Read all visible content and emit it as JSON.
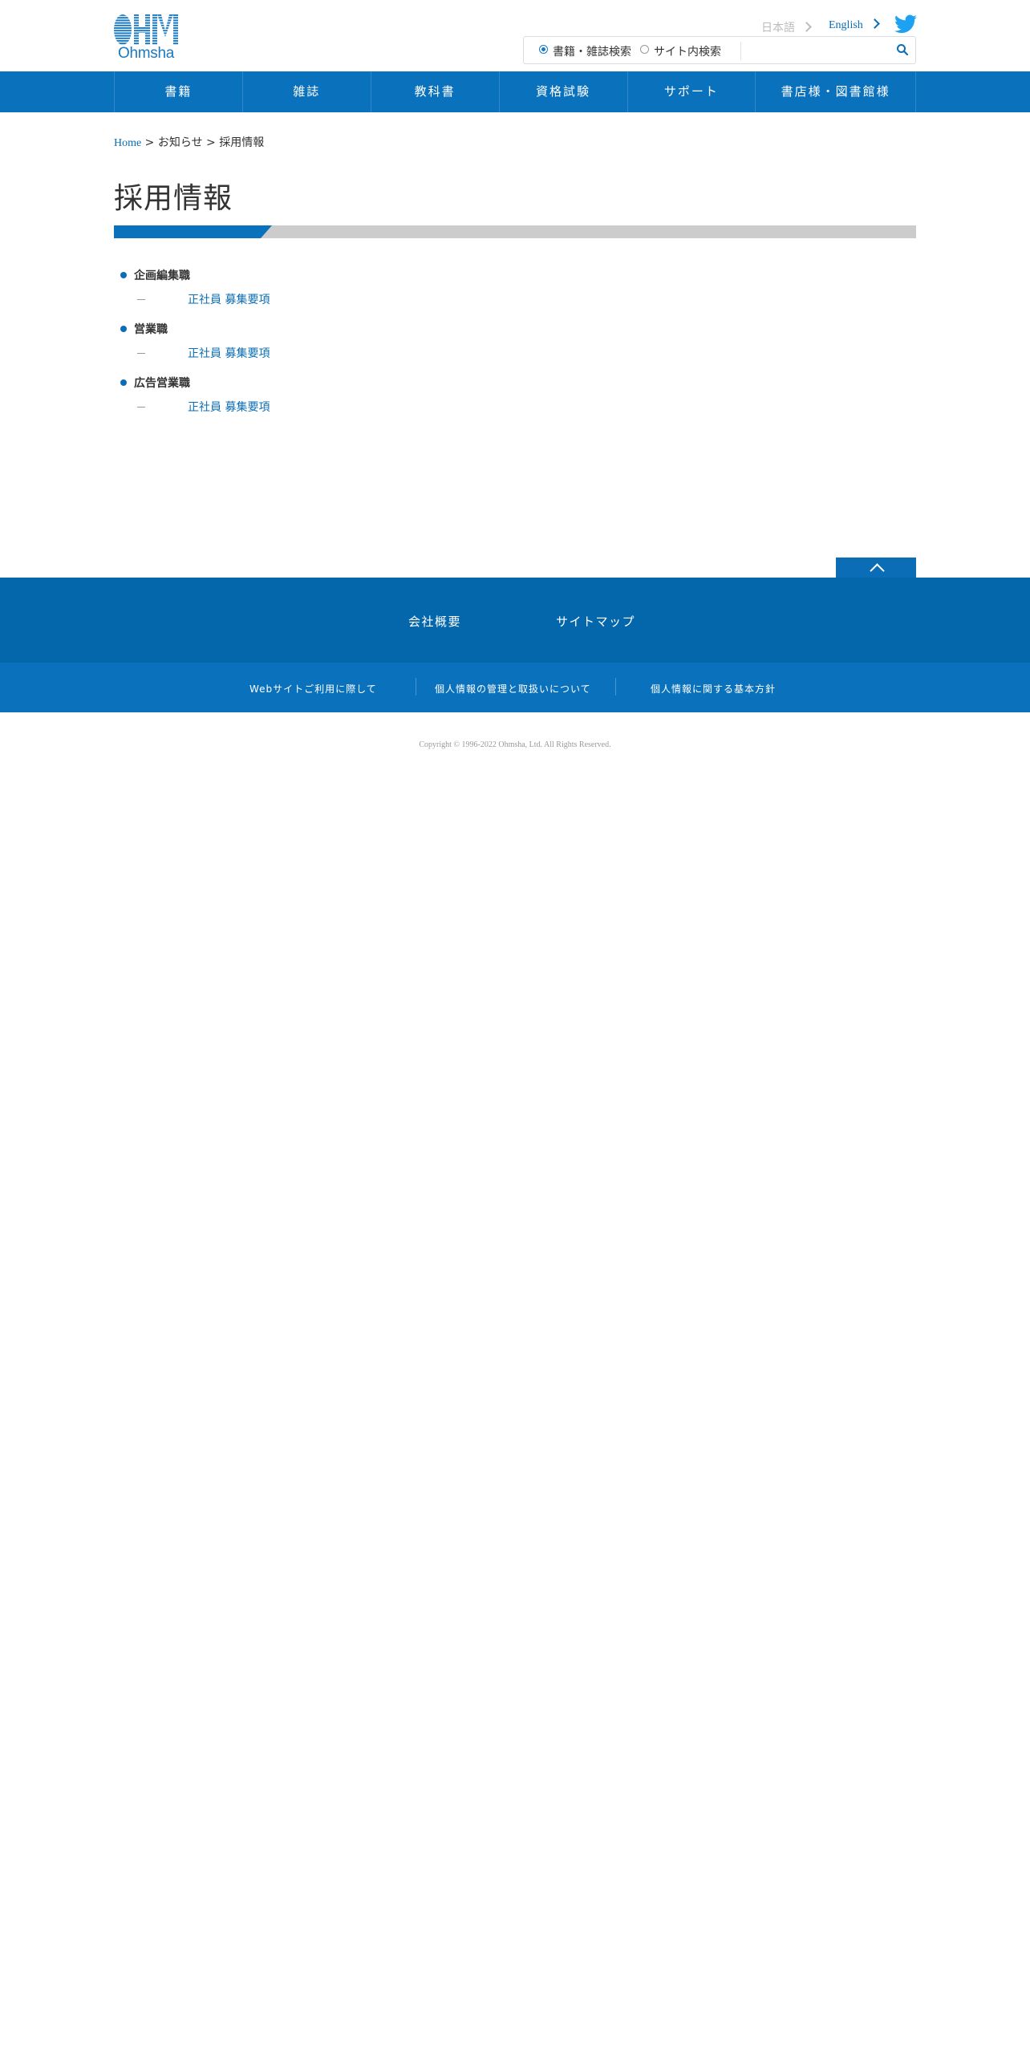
{
  "header": {
    "logo_text": "Ohmsha",
    "lang_ja": "日本語",
    "lang_en": "English",
    "search": {
      "option_books": "書籍・雑誌検索",
      "option_site": "サイト内検索",
      "selected": "書籍・雑誌検索",
      "value": "",
      "placeholder": ""
    }
  },
  "nav": {
    "items": [
      {
        "label": "書籍"
      },
      {
        "label": "雑誌"
      },
      {
        "label": "教科書"
      },
      {
        "label": "資格試験"
      },
      {
        "label": "サポート"
      },
      {
        "label": "書店様・図書館様"
      }
    ]
  },
  "breadcrumb": {
    "home": "Home",
    "sep1": " > ",
    "news": "お知らせ",
    "sep2": " > ",
    "current": "採用情報"
  },
  "page": {
    "title": "採用情報"
  },
  "jobs": [
    {
      "title": "企画編集職",
      "link": "正社員 募集要項"
    },
    {
      "title": "営業職",
      "link": "正社員 募集要項"
    },
    {
      "title": "広告営業職",
      "link": "正社員 募集要項"
    }
  ],
  "footer": {
    "primary_links": [
      "会社概要",
      "サイトマップ"
    ],
    "secondary_links": [
      "Webサイトご利用に際して",
      "個人情報の管理と取扱いについて",
      "個人情報に関する基本方針"
    ],
    "copyright": "Copyright © 1996-2022 Ohmsha, Ltd. All Rights Reserved."
  },
  "colors": {
    "brand_blue": "#0a72bd",
    "footer_dark": "#0567ab",
    "link_blue": "#0a6db5",
    "twitter_blue": "#1da1f2"
  },
  "icons": [
    "ohm-logo-icon",
    "chevron-right-icon",
    "twitter-icon",
    "search-icon",
    "chevron-up-icon"
  ]
}
